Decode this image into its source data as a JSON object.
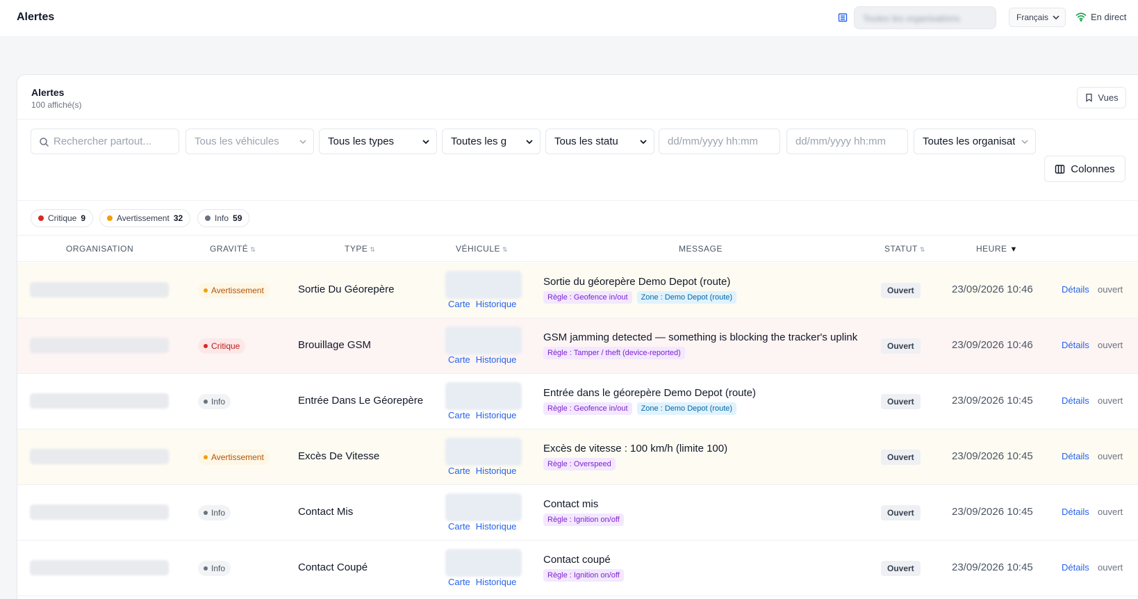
{
  "header": {
    "title": "Alertes",
    "org_selector": "Toutes les organisations",
    "language": "Français",
    "live_label": "En direct"
  },
  "card": {
    "title": "Alertes",
    "subtitle": "100 affiché(s)",
    "views_label": "Vues"
  },
  "filters": {
    "search_placeholder": "Rechercher partout...",
    "vehicles": "Tous les véhicules",
    "types": "Tous les types",
    "severities": "Toutes les g",
    "statuses": "Tous les statu",
    "date_from_placeholder": "dd/mm/yyyy hh:mm",
    "date_to_placeholder": "dd/mm/yyyy hh:mm",
    "organisations": "Toutes les organisat",
    "columns_label": "Colonnes"
  },
  "severity_summary": [
    {
      "label": "Critique",
      "count": "9",
      "color": "#dc2626"
    },
    {
      "label": "Avertissement",
      "count": "32",
      "color": "#f59e0b"
    },
    {
      "label": "Info",
      "count": "59",
      "color": "#6b7280"
    }
  ],
  "table": {
    "headers": {
      "organisation": "ORGANISATION",
      "gravite": "GRAVITÉ",
      "type": "TYPE",
      "vehicule": "VÉHICULE",
      "message": "MESSAGE",
      "statut": "STATUT",
      "heure": "HEURE"
    },
    "link_map": "Carte",
    "link_history": "Historique",
    "link_details": "Détails",
    "rows": [
      {
        "severity": "Avertissement",
        "type": "Sortie Du Géorepère",
        "message": "Sortie du géorepère Demo Depot (route)",
        "rule": "Règle : Geofence in/out",
        "zone": "Zone : Demo Depot (route)",
        "status": "Ouvert",
        "time": "23/09/2026 10:46",
        "state": "ouvert"
      },
      {
        "severity": "Critique",
        "type": "Brouillage GSM",
        "message": "GSM jamming detected — something is blocking the tracker's uplink",
        "rule": "Règle : Tamper / theft (device-reported)",
        "status": "Ouvert",
        "time": "23/09/2026 10:46",
        "state": "ouvert"
      },
      {
        "severity": "Info",
        "type": "Entrée Dans Le Géorepère",
        "message": "Entrée dans le géorepère Demo Depot (route)",
        "rule": "Règle : Geofence in/out",
        "zone": "Zone : Demo Depot (route)",
        "status": "Ouvert",
        "time": "23/09/2026 10:45",
        "state": "ouvert"
      },
      {
        "severity": "Avertissement",
        "type": "Excès De Vitesse",
        "message": "Excès de vitesse : 100 km/h (limite 100)",
        "rule": "Règle : Overspeed",
        "status": "Ouvert",
        "time": "23/09/2026 10:45",
        "state": "ouvert"
      },
      {
        "severity": "Info",
        "type": "Contact Mis",
        "message": "Contact mis",
        "rule": "Règle : Ignition on/off",
        "status": "Ouvert",
        "time": "23/09/2026 10:45",
        "state": "ouvert"
      },
      {
        "severity": "Info",
        "type": "Contact Coupé",
        "message": "Contact coupé",
        "rule": "Règle : Ignition on/off",
        "status": "Ouvert",
        "time": "23/09/2026 10:45",
        "state": "ouvert"
      }
    ]
  }
}
